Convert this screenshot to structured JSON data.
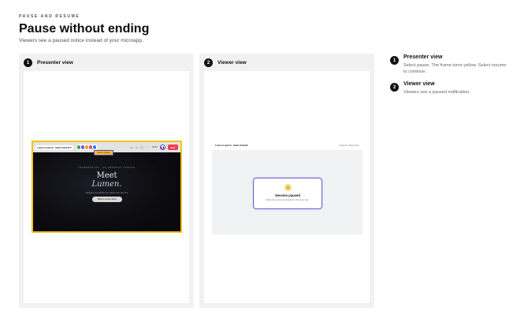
{
  "header": {
    "eyebrow": "PAUSE AND RESUME",
    "title": "Pause without ending",
    "subtitle": "Viewers see a paused notice instead of your microapp."
  },
  "panels": [
    {
      "number": "1",
      "title": "Presenter view"
    },
    {
      "number": "2",
      "title": "Viewer view"
    }
  ],
  "presenter": {
    "toolbar_title": "Lumen Launch · Sales Kickoff ▾",
    "avatar_colors": [
      "#3aa55d",
      "#7a5af5",
      "#f0a21b",
      "#e24b8b",
      "#3b82f6"
    ],
    "toolbar_icons": [
      "screen-icon",
      "people-icon",
      "chat-icon",
      "more-icon"
    ],
    "timer": "00:42",
    "pause_glyph": "❚❚",
    "end_label": "End",
    "paused_tag": "Session paused",
    "stage": {
      "eyebrow": "INTRODUCING · Q3 PRODUCT LAUNCH",
      "headline": "Meet",
      "headline_italic": "Lumen.",
      "subline": "Research everything your whole team can see",
      "button": "Book a Lumen demo"
    },
    "accent_border": "#f0c419"
  },
  "viewer": {
    "title": "Lumen Launch · Sales Kickoff",
    "host": "Hosted by Maya Chen",
    "notice": {
      "glyph": "II",
      "title": "Session paused",
      "subtitle": "Maya Chen paused the broadcast. It'll resume here."
    }
  },
  "steps": [
    {
      "number": "1",
      "title": "Presenter view",
      "description": "Select pause. The frame turns yellow. Select resume to continue."
    },
    {
      "number": "2",
      "title": "Viewer view",
      "description": "Viewers see a paused notification."
    }
  ]
}
